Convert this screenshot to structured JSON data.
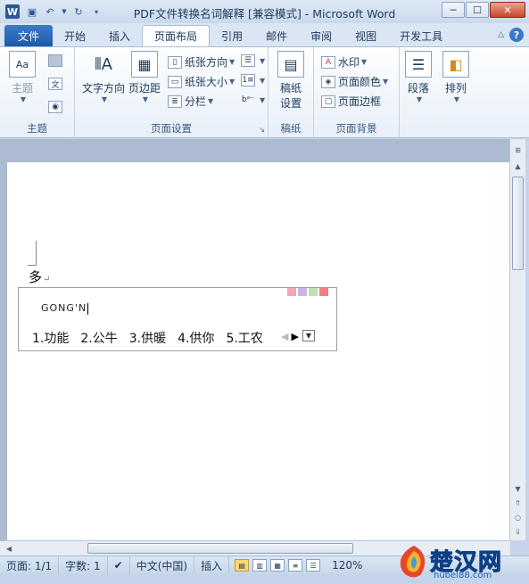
{
  "window": {
    "title": "PDF文件转换名词解释 [兼容模式] - Microsoft Word",
    "app_icon": "W",
    "buttons": {
      "minimize": "─",
      "maximize": "☐",
      "close": "✕"
    }
  },
  "tabs": [
    {
      "label": "文件"
    },
    {
      "label": "开始"
    },
    {
      "label": "插入"
    },
    {
      "label": "页面布局"
    },
    {
      "label": "引用"
    },
    {
      "label": "邮件"
    },
    {
      "label": "审阅"
    },
    {
      "label": "视图"
    },
    {
      "label": "开发工具"
    }
  ],
  "ribbon": {
    "theme_group": {
      "label": "主题",
      "theme_btn": "主题"
    },
    "page_setup_group": {
      "label": "页面设置",
      "text_direction": "文字方向",
      "margins": "页边距",
      "orientation": "纸张方向",
      "size": "纸张大小",
      "columns": "分栏"
    },
    "draft_group": {
      "label": "稿纸",
      "draft_btn_line1": "稿纸",
      "draft_btn_line2": "设置"
    },
    "background_group": {
      "label": "页面背景",
      "watermark": "水印",
      "page_color": "页面颜色",
      "page_border": "页面边框"
    },
    "paragraph_btn": "段落",
    "arrange_btn": "排列"
  },
  "document": {
    "text": "多",
    "para_mark": "↵"
  },
  "ime": {
    "input": "GONG'N",
    "candidates": [
      "1.功能",
      "2.公牛",
      "3.供暖",
      "4.供你",
      "5.工农"
    ],
    "swatch_colors": [
      "#f2a6b6",
      "#c8b8e0",
      "#bfe0b0",
      "#f08080"
    ]
  },
  "statusbar": {
    "page": "页面: 1/1",
    "words": "字数: 1",
    "language": "中文(中国)",
    "mode": "插入",
    "zoom": "120%"
  },
  "watermark": {
    "text": "楚汉网",
    "url": "hubei88.com"
  }
}
